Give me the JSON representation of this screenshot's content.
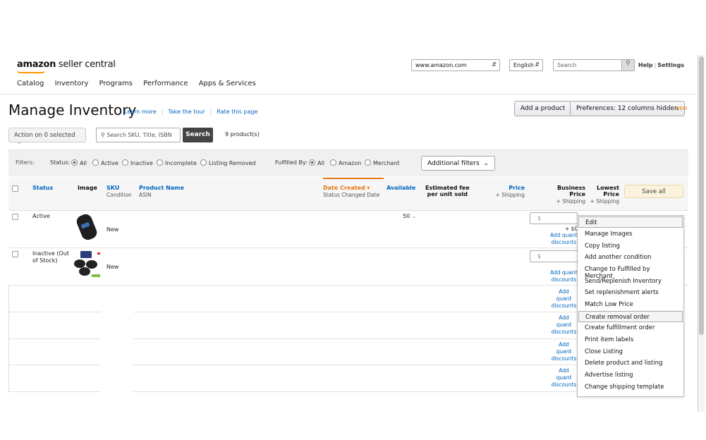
{
  "header": {
    "logo_bold": "amazon",
    "logo_rest": " seller central",
    "domain": "www.amazon.com",
    "language": "English",
    "search_placeholder": "Search",
    "help": "Help",
    "settings": "Settings"
  },
  "nav": [
    "Catalog",
    "Inventory",
    "Programs",
    "Performance",
    "Apps & Services"
  ],
  "page": {
    "title": "Manage Inventory",
    "learn_more": "Learn more",
    "take_tour": "Take the tour",
    "rate_page": "Rate this page",
    "add_product": "Add a product",
    "preferences": "Preferences: 12 columns hidden",
    "new_badge": "NEW",
    "action_select": "Action on 0 selected",
    "search_placeholder": "Search SKU, Title, ISBN",
    "search_button": "Search",
    "product_count": "9 product(s)"
  },
  "filters": {
    "label": "Filters:",
    "status_label": "Status:",
    "status_options": [
      "All",
      "Active",
      "Inactive",
      "Incomplete",
      "Listing Removed"
    ],
    "fulfilled_label": "Fulfilled By:",
    "fulfilled_options": [
      "All",
      "Amazon",
      "Merchant"
    ],
    "additional": "Additional filters"
  },
  "table_header": {
    "status": "Status",
    "image": "Image",
    "sku": "SKU",
    "condition": "Condition",
    "product_name": "Product Name",
    "asin": "ASIN",
    "date_created": "Date Created",
    "status_changed": "Status Changed Date",
    "available": "Available",
    "est_fee_1": "Estimated fee",
    "est_fee_2": "per unit sold",
    "price": "Price",
    "price_sub": "+ Shipping",
    "business_price": "Business Price",
    "business_sub": "+ Shipping",
    "lowest_1": "Lowest",
    "lowest_2": "Price",
    "lowest_sub": "+ Shipping",
    "save_all": "Save all"
  },
  "rows": [
    {
      "status": "Active",
      "condition": "New",
      "available": "50",
      "price_placeholder": "$",
      "business_note": "+ $0",
      "addq_1": "Add quant",
      "addq_2": "discounts"
    },
    {
      "status_1": "Inactive (Out",
      "status_2": "of Stock)",
      "condition": "New",
      "price_placeholder": "$",
      "addq_1": "Add quant",
      "addq_2": "discounts"
    }
  ],
  "blank_rows_addq": [
    {
      "a": "Add quant",
      "b": "discounts"
    },
    {
      "a": "Add quant",
      "b": "discounts"
    },
    {
      "a": "Add quant",
      "b": "discounts"
    },
    {
      "a": "Add quant",
      "b": "discounts"
    }
  ],
  "menu": [
    "Edit",
    "Manage Images",
    "Copy listing",
    "Add another condition",
    "Change to Fulfilled by Merchant",
    "Send/Replenish Inventory",
    "Set replenishment alerts",
    "Match Low Price",
    "Create removal order",
    "Create fulfillment order",
    "Print item labels",
    "Close Listing",
    "Delete product and listing",
    "Advertise listing",
    "Change shipping template"
  ],
  "colors": {
    "link": "#0066c0",
    "accent": "#e47911",
    "search_button": "#444444"
  }
}
